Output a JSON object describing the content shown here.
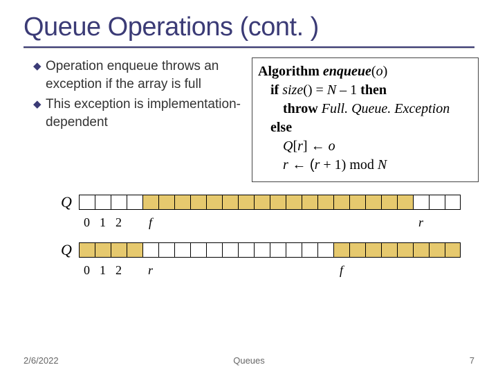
{
  "title": "Queue Operations (cont. )",
  "bullets": [
    "Operation enqueue throws an exception if the array is full",
    "This exception is implementation-dependent"
  ],
  "algorithm": {
    "header_kw": "Algorithm",
    "header_name": "enqueue",
    "header_param": "o",
    "line1_kw_if": "if",
    "line1_size": "size",
    "line1_eq": "() = ",
    "line1_N": "N",
    "line1_minus1": " – 1 ",
    "line1_kw_then": "then",
    "line2_kw_throw": "throw",
    "line2_exc": "Full. Queue. Exception",
    "line3_kw_else": "else",
    "line4_Q": "Q",
    "line4_bracket_open": "[",
    "line4_r": "r",
    "line4_bracket_close": "] ",
    "line4_arrow": "←",
    "line4_o": " o",
    "line5_r1": "r",
    "line5_arrow": " ← (",
    "line5_r2": "r",
    "line5_plus": " + 1) mod ",
    "line5_N": "N"
  },
  "queue1": {
    "label": "Q",
    "cells": [
      0,
      0,
      0,
      0,
      1,
      1,
      1,
      1,
      1,
      1,
      1,
      1,
      1,
      1,
      1,
      1,
      1,
      1,
      1,
      1,
      1,
      0,
      0,
      0
    ],
    "indices": [
      "0",
      "1",
      "2",
      "",
      "f",
      "",
      "",
      "",
      "",
      "",
      "",
      "",
      "",
      "",
      "",
      "",
      "",
      "",
      "",
      "",
      "",
      "r",
      "",
      ""
    ]
  },
  "queue2": {
    "label": "Q",
    "cells": [
      1,
      1,
      1,
      1,
      0,
      0,
      0,
      0,
      0,
      0,
      0,
      0,
      0,
      0,
      0,
      0,
      1,
      1,
      1,
      1,
      1,
      1,
      1,
      1
    ],
    "indices": [
      "0",
      "1",
      "2",
      "",
      "r",
      "",
      "",
      "",
      "",
      "",
      "",
      "",
      "",
      "",
      "",
      "",
      "f",
      "",
      "",
      "",
      "",
      "",
      "",
      ""
    ]
  },
  "footer": {
    "date": "2/6/2022",
    "topic": "Queues",
    "page": "7"
  }
}
